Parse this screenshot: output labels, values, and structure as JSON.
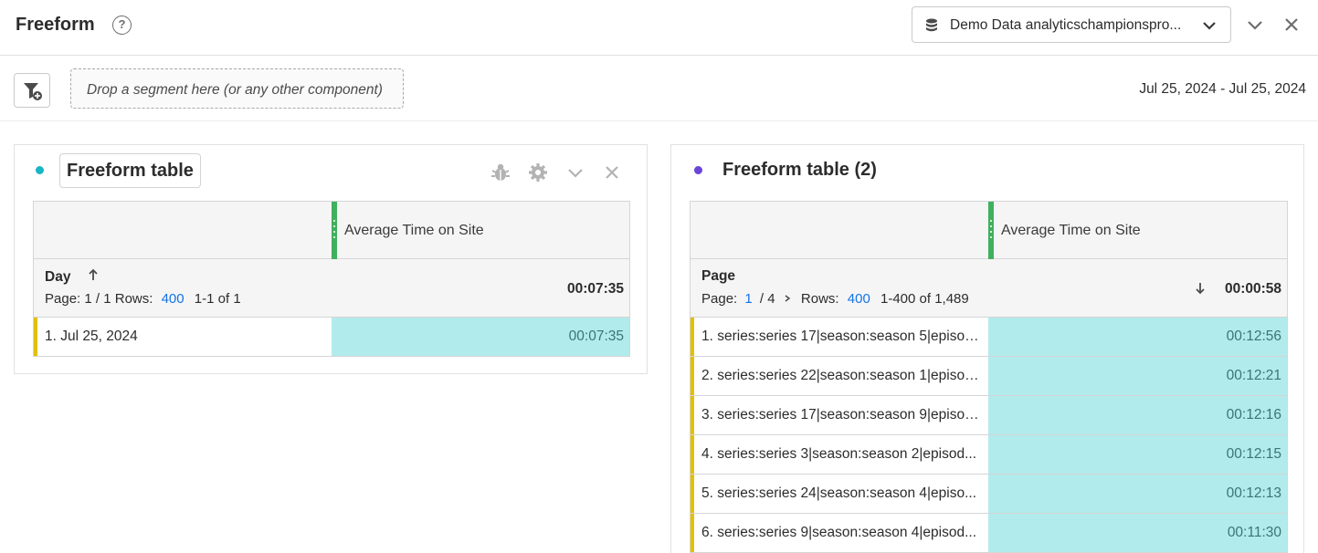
{
  "header": {
    "title": "Freeform",
    "help_glyph": "?",
    "datasource_label": "Demo Data analyticschampionspro..."
  },
  "segment_bar": {
    "dropzone_text": "Drop a segment here (or any other component)",
    "date_range": "Jul 25, 2024 - Jul 25, 2024"
  },
  "colors": {
    "left_panel_dot": "#19b5c4",
    "right_panel_dot": "#6a45d8",
    "metric_cell": "#b2ebeb",
    "row_marker": "#e1c100",
    "link_blue": "#1473e6"
  },
  "left_panel": {
    "title": "Freeform table",
    "icons": [
      "bug-icon",
      "gear-icon",
      "chevron-down-icon",
      "close-icon"
    ],
    "metric": "Average Time on Site",
    "dimension": "Day",
    "pager": {
      "page_label": "Page: 1 / 1",
      "rows_label": "Rows:",
      "rows_value": "400",
      "range": "1-1 of 1"
    },
    "total": "00:07:35",
    "rows": [
      {
        "label": "1.  Jul 25, 2024",
        "value": "00:07:35"
      }
    ]
  },
  "right_panel": {
    "title": "Freeform table (2)",
    "metric": "Average Time on Site",
    "dimension": "Page",
    "pager": {
      "page_prefix": "Page:",
      "page_current": "1",
      "page_total": "/ 4",
      "rows_label": "Rows:",
      "rows_value": "400",
      "range": "1-400 of 1,489"
    },
    "total": "00:00:58",
    "rows": [
      {
        "label": "1.  series:series 17|season:season 5|episod...",
        "value": "00:12:56"
      },
      {
        "label": "2.  series:series 22|season:season 1|episod...",
        "value": "00:12:21"
      },
      {
        "label": "3.  series:series 17|season:season 9|episod...",
        "value": "00:12:16"
      },
      {
        "label": "4.  series:series 3|season:season 2|episod...",
        "value": "00:12:15"
      },
      {
        "label": "5.  series:series 24|season:season 4|episo...",
        "value": "00:12:13"
      },
      {
        "label": "6.  series:series 9|season:season 4|episod...",
        "value": "00:11:30"
      }
    ]
  }
}
